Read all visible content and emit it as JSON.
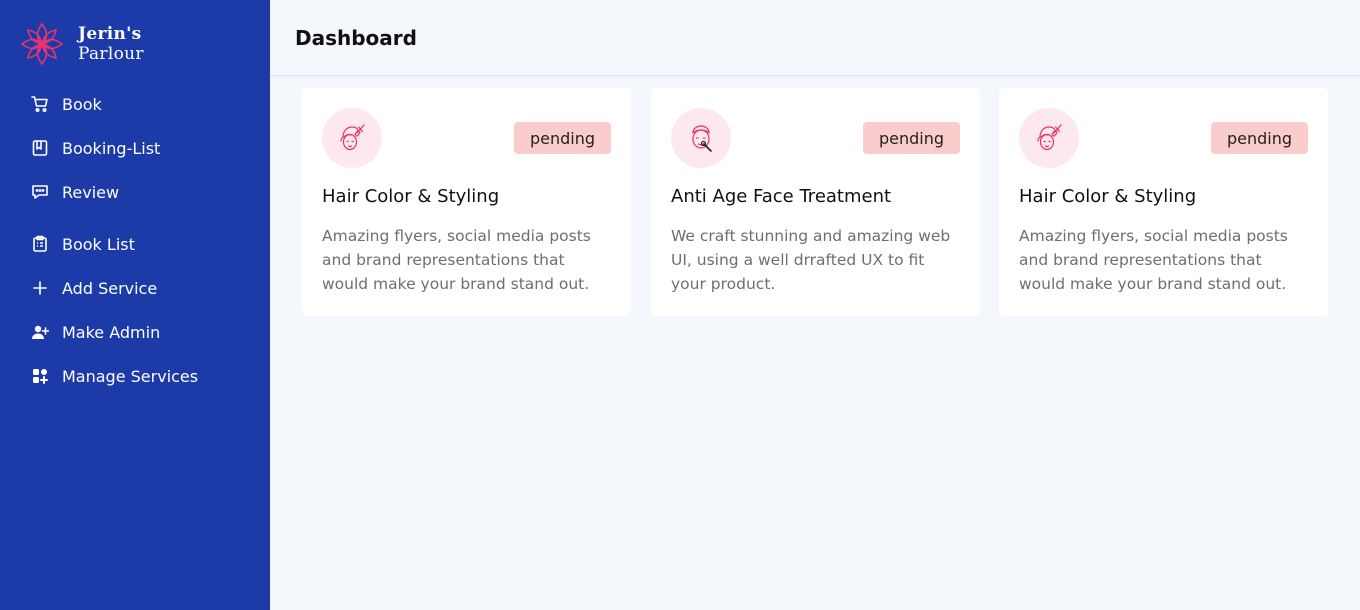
{
  "brand": {
    "name_line1": "Jerin's",
    "name_line2": "Parlour"
  },
  "sidebar": {
    "items": [
      {
        "label": "Book",
        "icon": "cart-icon"
      },
      {
        "label": "Booking-List",
        "icon": "list-book-icon"
      },
      {
        "label": "Review",
        "icon": "comment-icon"
      },
      {
        "label": "Book List",
        "icon": "clipboard-icon"
      },
      {
        "label": "Add Service",
        "icon": "plus-icon"
      },
      {
        "label": "Make Admin",
        "icon": "user-plus-icon"
      },
      {
        "label": "Manage Services",
        "icon": "grid-icon"
      }
    ]
  },
  "header": {
    "title": "Dashboard"
  },
  "cards": [
    {
      "icon": "hair-styling-icon",
      "status": "pending",
      "title": "Hair Color & Styling",
      "description": "Amazing flyers, social media posts and brand representations that would make your brand stand out."
    },
    {
      "icon": "face-treatment-icon",
      "status": "pending",
      "title": "Anti Age Face Treatment",
      "description": "We craft stunning and amazing web UI, using a well drrafted UX to fit your product."
    },
    {
      "icon": "hair-styling-icon",
      "status": "pending",
      "title": "Hair Color & Styling",
      "description": "Amazing flyers, social media posts and brand representations that would make your brand stand out."
    }
  ],
  "colors": {
    "sidebar": "#1d3aa9",
    "background": "#f4f7fc",
    "accent_pink": "#e8336d",
    "badge": "#fbcccc"
  }
}
